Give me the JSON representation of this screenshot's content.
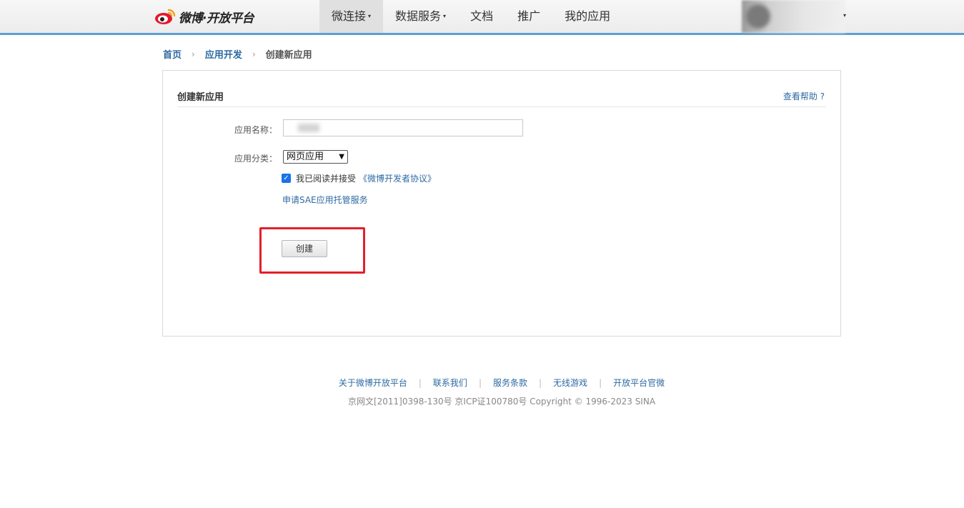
{
  "header": {
    "logo_text": "微博·开放平台",
    "nav": [
      {
        "label": "微连接",
        "caret": "▾",
        "active": true
      },
      {
        "label": "数据服务",
        "caret": "▾",
        "active": false
      },
      {
        "label": "文档",
        "caret": "",
        "active": false
      },
      {
        "label": "推广",
        "caret": "",
        "active": false
      },
      {
        "label": "我的应用",
        "caret": "",
        "active": false
      }
    ],
    "user_caret": "▾"
  },
  "breadcrumb": {
    "home": "首页",
    "app_dev": "应用开发",
    "current": "创建新应用",
    "separator": "›"
  },
  "form": {
    "title": "创建新应用",
    "help_link": "查看帮助 ?",
    "name_label": "应用名称：",
    "category_label": "应用分类：",
    "category_value": "网页应用",
    "agree_checked": true,
    "agree_text": "我已阅读并接受",
    "agree_link": "《微博开发者协议》",
    "sae_link": "申请SAE应用托管服务",
    "create_button": "创建"
  },
  "footer": {
    "links": [
      "关于微博开放平台",
      "联系我们",
      "服务条款",
      "无线游戏",
      "开放平台官微"
    ],
    "copyright": "京网文[2011]0398-130号 京ICP证100780号 Copyright © 1996-2023 SINA"
  },
  "colors": {
    "link": "#2e6aa2",
    "header_border": "#5d9fd6",
    "highlight": "#e3202b",
    "checkbox": "#1a73e8"
  }
}
